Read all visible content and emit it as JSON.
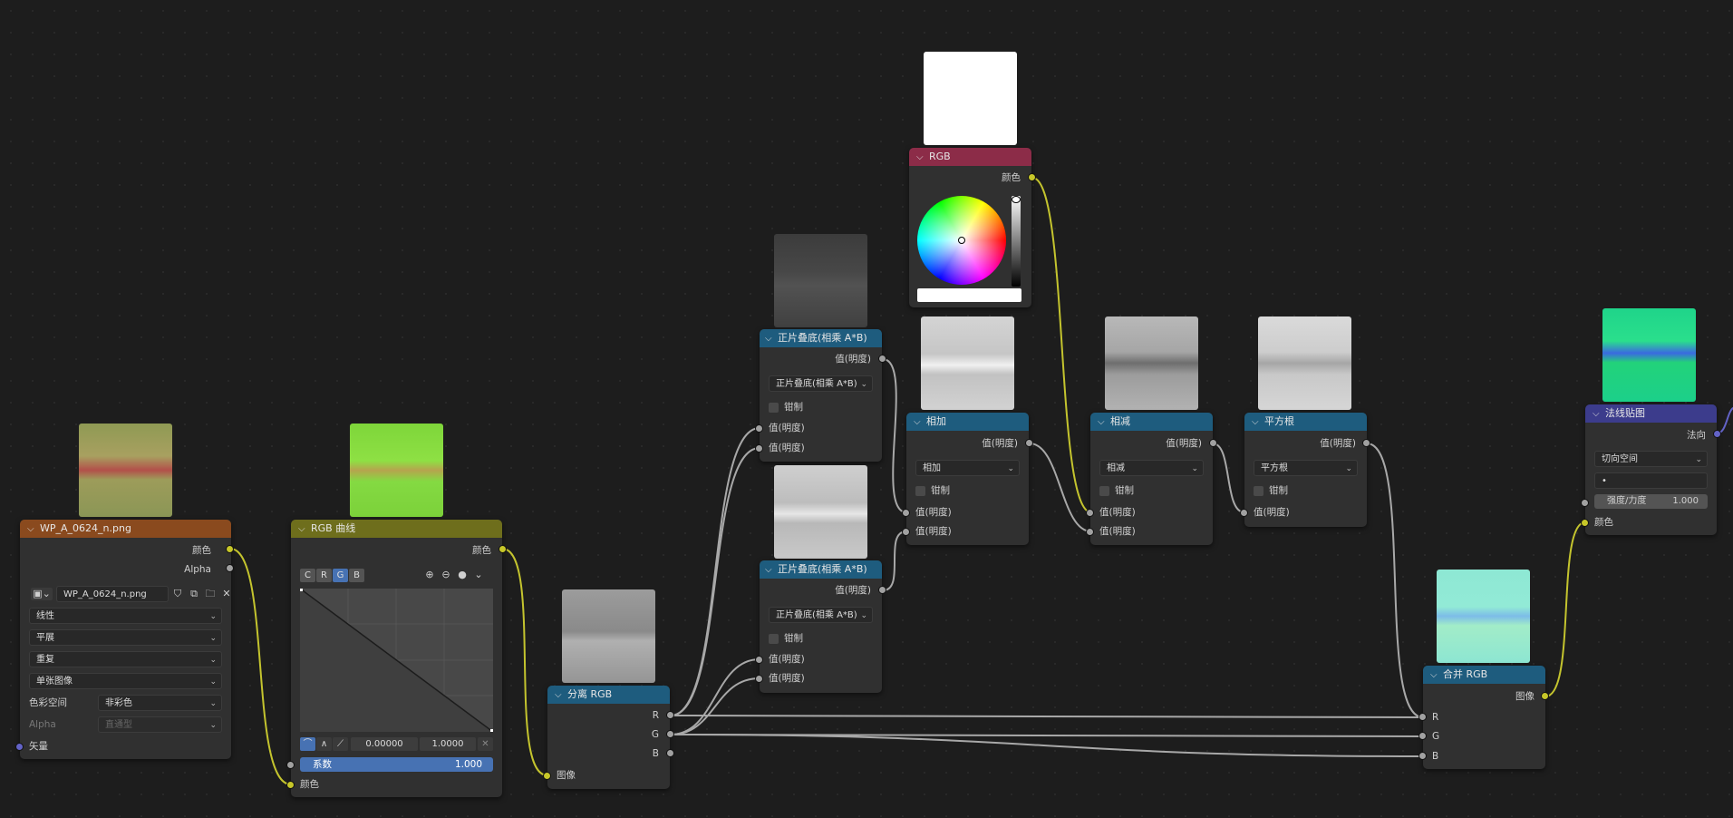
{
  "nodes": {
    "image_texture": {
      "title": "WP_A_0624_n.png",
      "header_color": "#8a4a1e",
      "outputs": [
        "颜色",
        "Alpha"
      ],
      "image_name": "WP_A_0624_n.png",
      "interpolation": "线性",
      "projection": "平展",
      "extension": "重复",
      "source": "单张图像",
      "color_space_label": "色彩空间",
      "color_space_value": "非彩色",
      "alpha_label": "Alpha",
      "alpha_value": "直通型",
      "input_vector": "矢量"
    },
    "rgb_curves": {
      "title": "RGB 曲线",
      "header_color": "#6e6e1c",
      "output": "颜色",
      "channels": [
        "C",
        "R",
        "G",
        "B"
      ],
      "active_channel": "G",
      "min_value": "0.00000",
      "max_value": "1.0000",
      "factor_label": "系数",
      "factor_value": "1.000",
      "input_color": "颜色"
    },
    "separate_rgb": {
      "title": "分离 RGB",
      "header_color": "#1e5c7e",
      "outputs": [
        "R",
        "G",
        "B"
      ],
      "input": "图像"
    },
    "multiply_1": {
      "title": "正片叠底(相乘 A*B)",
      "output": "值(明度)",
      "operation": "正片叠底(相乘 A*B)",
      "clamp": "钳制",
      "inputs": [
        "值(明度)",
        "值(明度)"
      ]
    },
    "multiply_2": {
      "title": "正片叠底(相乘 A*B)",
      "output": "值(明度)",
      "operation": "正片叠底(相乘 A*B)",
      "clamp": "钳制",
      "inputs": [
        "值(明度)",
        "值(明度)"
      ]
    },
    "rgb": {
      "title": "RGB",
      "header_color": "#8c2c48",
      "output": "颜色"
    },
    "add": {
      "title": "相加",
      "output": "值(明度)",
      "operation": "相加",
      "clamp": "钳制",
      "inputs": [
        "值(明度)",
        "值(明度)"
      ]
    },
    "subtract": {
      "title": "相减",
      "output": "值(明度)",
      "operation": "相减",
      "clamp": "钳制",
      "inputs": [
        "值(明度)",
        "值(明度)"
      ]
    },
    "sqrt": {
      "title": "平方根",
      "output": "值(明度)",
      "operation": "平方根",
      "clamp": "钳制",
      "inputs": [
        "值(明度)"
      ]
    },
    "combine_rgb": {
      "title": "合并 RGB",
      "output": "图像",
      "inputs": [
        "R",
        "G",
        "B"
      ]
    },
    "normal_map": {
      "title": "法线贴图",
      "header_color": "#3c3c8c",
      "output": "法向",
      "space": "切向空间",
      "uv_value": "•",
      "strength_label": "强度/力度",
      "strength_value": "1.000",
      "input_color": "颜色"
    }
  },
  "colors": {
    "converter_header": "#1e5c7e",
    "socket_color": "#c7c729",
    "socket_value": "#a1a1a1",
    "socket_vector": "#6363c7",
    "wire_color": "#c4c42e",
    "wire_value": "#a8a8a8"
  }
}
